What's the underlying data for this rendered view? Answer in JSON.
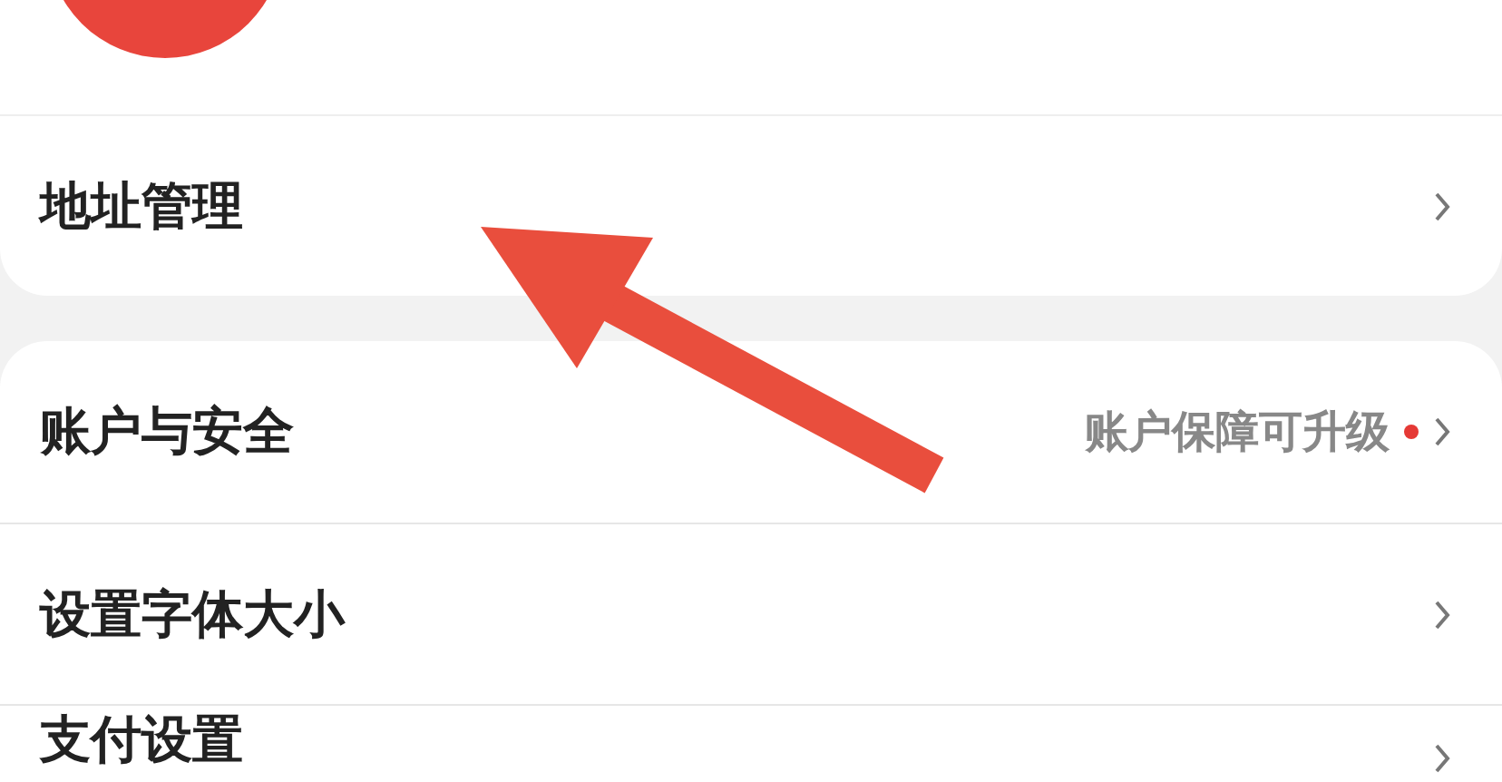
{
  "address_card": {
    "label": "地址管理"
  },
  "settings": [
    {
      "label": "账户与安全",
      "note": "账户保障可升级",
      "dot": true
    },
    {
      "label": "设置字体大小",
      "dot": false
    },
    {
      "label": "支付设置",
      "dot": false
    }
  ]
}
